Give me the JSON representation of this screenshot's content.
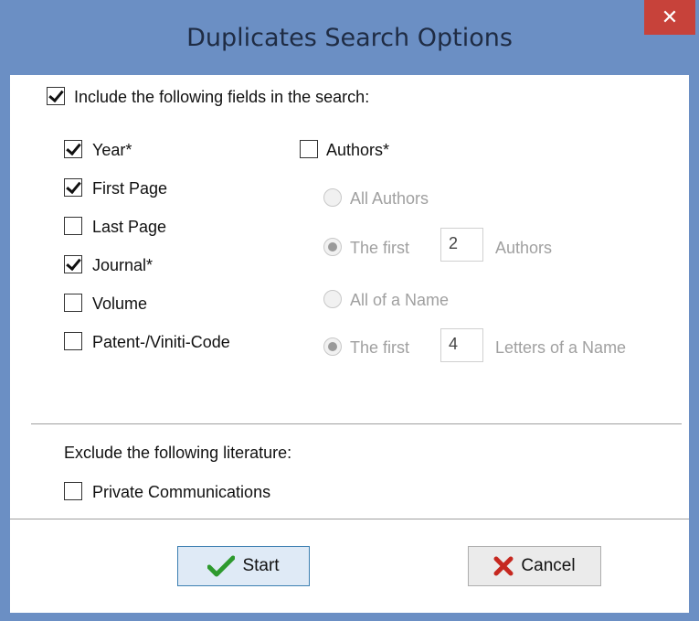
{
  "window": {
    "title": "Duplicates Search Options",
    "close_label": "✕"
  },
  "include": {
    "label": "Include the following fields in the search:",
    "checked": true
  },
  "fields": {
    "year": {
      "label": "Year*",
      "checked": true
    },
    "first_page": {
      "label": "First Page",
      "checked": true
    },
    "last_page": {
      "label": "Last Page",
      "checked": false
    },
    "journal": {
      "label": "Journal*",
      "checked": true
    },
    "volume": {
      "label": "Volume",
      "checked": false
    },
    "patent": {
      "label": "Patent-/Viniti-Code",
      "checked": false
    }
  },
  "authors": {
    "label": "Authors*",
    "checked": false,
    "all_authors": "All Authors",
    "the_first": "The first",
    "first_count": "2",
    "authors_suffix": "Authors",
    "all_of_name": "All of a Name",
    "the_first_letters": "The first",
    "letters_count": "4",
    "letters_suffix": "Letters of a Name"
  },
  "exclude": {
    "label": "Exclude the following literature:",
    "private": {
      "label": "Private Communications",
      "checked": false
    }
  },
  "buttons": {
    "start": "Start",
    "cancel": "Cancel"
  },
  "colors": {
    "titlebar": "#6b8fc4",
    "close": "#c7423a",
    "start_check": "#2e9a2e",
    "cancel_x": "#c62820"
  }
}
